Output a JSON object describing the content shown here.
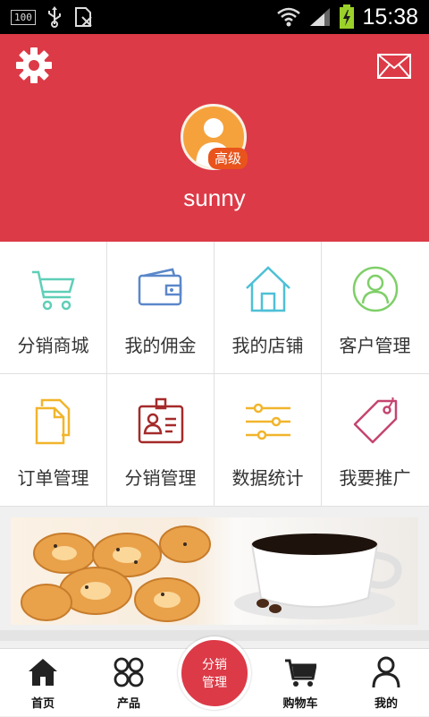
{
  "status": {
    "battery_text": "100",
    "time": "15:38"
  },
  "profile": {
    "level_badge": "高级",
    "username": "sunny"
  },
  "menu": [
    {
      "label": "分销商城",
      "icon": "cart-icon"
    },
    {
      "label": "我的佣金",
      "icon": "wallet-icon"
    },
    {
      "label": "我的店铺",
      "icon": "home-icon"
    },
    {
      "label": "客户管理",
      "icon": "user-circle-icon"
    },
    {
      "label": "订单管理",
      "icon": "documents-icon"
    },
    {
      "label": "分销管理",
      "icon": "id-badge-icon"
    },
    {
      "label": "数据统计",
      "icon": "sliders-icon"
    },
    {
      "label": "我要推广",
      "icon": "tag-icon"
    }
  ],
  "tabs": [
    {
      "label": "首页",
      "icon": "home-icon"
    },
    {
      "label": "产品",
      "icon": "grid-icon"
    },
    {
      "label": "购物车",
      "icon": "cart-icon"
    },
    {
      "label": "我的",
      "icon": "person-icon"
    }
  ],
  "fab": {
    "line1": "分销",
    "line2": "管理"
  },
  "colors": {
    "brand_red": "#dc3a47",
    "avatar_orange": "#f6a23c"
  }
}
